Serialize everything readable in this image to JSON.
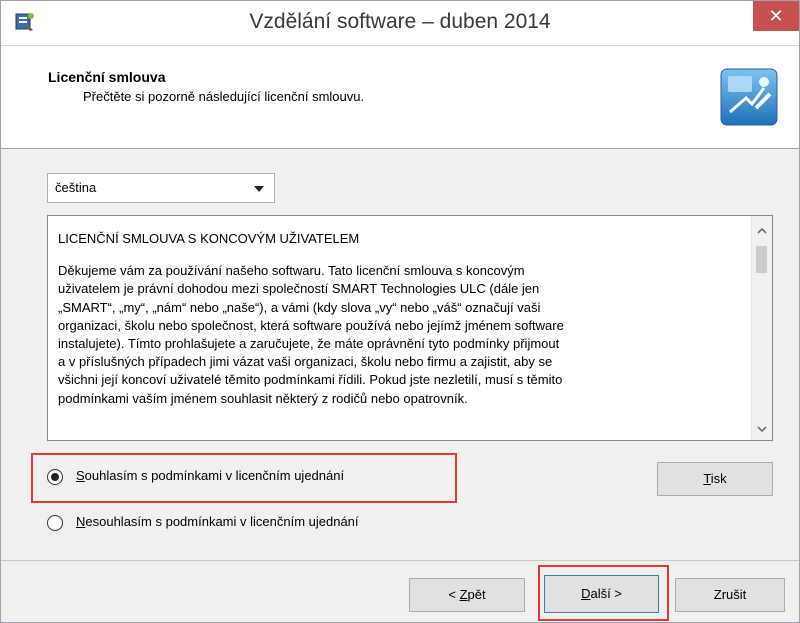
{
  "window": {
    "title": "Vzdělání software – duben 2014",
    "close_glyph": "✕"
  },
  "header": {
    "title": "Licenční smlouva",
    "subtitle": "Přečtěte si pozorně následující licenční smlouvu."
  },
  "language_select": {
    "value": "čeština"
  },
  "license": {
    "heading": "LICENČNÍ SMLOUVA S KONCOVÝM UŽIVATELEM",
    "lines": [
      "Děkujeme vám za používání našeho softwaru.  Tato licenční smlouva s koncovým",
      "uživatelem je právní dohodou mezi společností SMART Technologies ULC (dále jen",
      "„SMART“, „my“, „nám“ nebo „naše“), a vámi (kdy slova „vy“ nebo „váš“ označují vaši",
      "organizaci, školu nebo společnost, která software používá nebo jejímž jménem software",
      "instalujete).  Tímto prohlašujete a zaručujete, že máte oprávnění tyto podmínky přijmout",
      "a v příslušných případech jimi vázat vaši organizaci, školu nebo firmu a zajistit, aby se",
      "všichni její koncoví uživatelé těmito podmínkami řídili.  Pokud jste nezletilí, musí s těmito",
      "podmínkami vaším jménem souhlasit některý z rodičů nebo opatrovník."
    ]
  },
  "options": {
    "accept_first": "S",
    "accept_rest": "ouhlasím s podmínkami v licenčním ujednání",
    "decline_first": "N",
    "decline_rest": "esouhlasím s podmínkami v licenčním ujednání",
    "selected": "accept"
  },
  "buttons": {
    "print_first": "T",
    "print_rest": "isk",
    "back_pre": "< ",
    "back_u": "Z",
    "back_rest": "pět",
    "next_u": "D",
    "next_rest": "alší >",
    "cancel": "Zrušit"
  },
  "colors": {
    "highlight": "#e53935",
    "close": "#c75050"
  },
  "icons": {
    "app": "installer-icon",
    "header": "smart-board-icon",
    "dropdown": "chevron-down-icon",
    "scroll_up": "scroll-up-arrow",
    "scroll_down": "scroll-down-arrow"
  }
}
